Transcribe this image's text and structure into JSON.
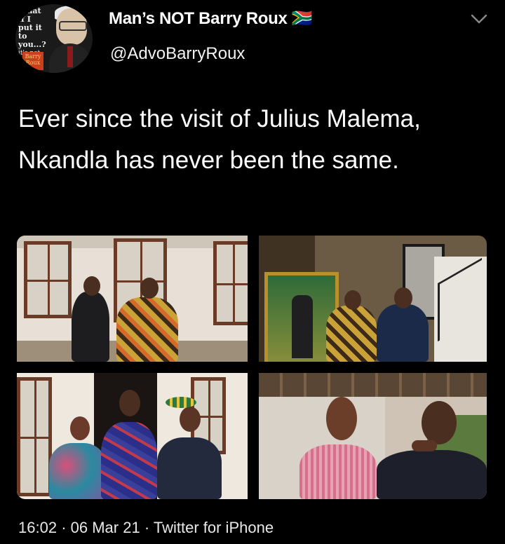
{
  "avatar": {
    "caption_lines": [
      "What",
      "if I",
      "put it",
      "to you...?",
      "it's not"
    ],
    "logo_text": "Barry Roux"
  },
  "header": {
    "display_name": "Man’s NOT Barry Roux 🇿🇦",
    "handle": "@AdvoBarryRoux",
    "menu_icon": "chevron-down-icon"
  },
  "tweet": {
    "text": "Ever since the visit of Julius Malema, Nkandla has never been the same."
  },
  "media": {
    "photos": [
      {
        "name": "photo-handshake-outdoors"
      },
      {
        "name": "photo-indoor-portrait-hall"
      },
      {
        "name": "photo-group-three-people"
      },
      {
        "name": "photo-two-men-conversation"
      }
    ]
  },
  "footer": {
    "time": "16:02",
    "separator": "·",
    "date": "06 Mar 21",
    "source": "Twitter for iPhone"
  }
}
